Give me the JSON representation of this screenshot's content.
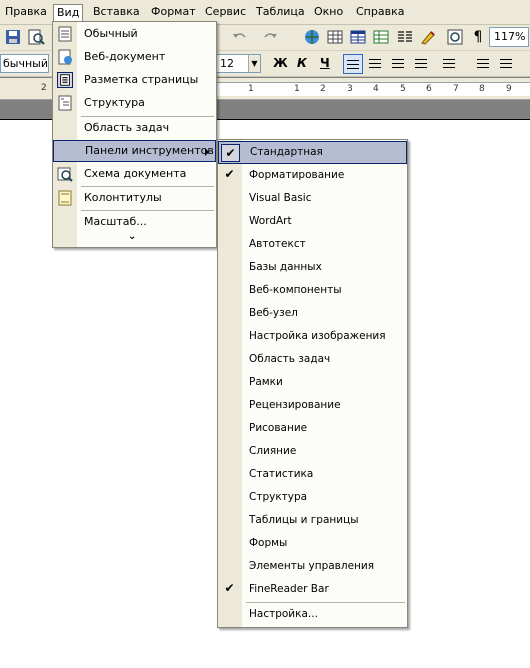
{
  "menubar": {
    "items": [
      {
        "label": "Правка"
      },
      {
        "label": "Вид"
      },
      {
        "label": "Вставка"
      },
      {
        "label": "Формат"
      },
      {
        "label": "Сервис"
      },
      {
        "label": "Таблица"
      },
      {
        "label": "Окно"
      },
      {
        "label": "Справка"
      }
    ],
    "active": "Вид"
  },
  "toolbar": {
    "zoom": "117%",
    "style": "бычный",
    "font_size": "12",
    "bold": "Ж",
    "italic": "К",
    "underline": "Ч"
  },
  "ruler": {
    "marks": [
      "2",
      "1",
      "1",
      "2",
      "3",
      "4",
      "5",
      "6",
      "7",
      "8",
      "9"
    ]
  },
  "view_menu": {
    "items": [
      {
        "label": "Обычный",
        "icon": "normal-view-icon"
      },
      {
        "label": "Веб-документ",
        "icon": "web-layout-icon"
      },
      {
        "label": "Разметка страницы",
        "icon": "print-layout-icon",
        "checked": true
      },
      {
        "label": "Структура",
        "icon": "outline-view-icon"
      },
      {
        "label": "Область задач"
      },
      {
        "label": "Панели инструментов",
        "submenu": true,
        "highlighted": true
      },
      {
        "label": "Схема документа",
        "icon": "document-map-icon"
      },
      {
        "label": "Колонтитулы",
        "icon": "header-footer-icon"
      },
      {
        "label": "Масштаб..."
      }
    ],
    "expand_glyph": "⌄"
  },
  "toolbars_submenu": {
    "items": [
      {
        "label": "Стандартная",
        "checked": true,
        "highlighted": true
      },
      {
        "label": "Форматирование",
        "checked": true
      },
      {
        "label": "Visual Basic"
      },
      {
        "label": "WordArt"
      },
      {
        "label": "Автотекст"
      },
      {
        "label": "Базы данных"
      },
      {
        "label": "Веб-компоненты"
      },
      {
        "label": "Веб-узел"
      },
      {
        "label": "Настройка изображения"
      },
      {
        "label": "Область задач"
      },
      {
        "label": "Рамки"
      },
      {
        "label": "Рецензирование"
      },
      {
        "label": "Рисование"
      },
      {
        "label": "Слияние"
      },
      {
        "label": "Статистика"
      },
      {
        "label": "Структура"
      },
      {
        "label": "Таблицы и границы"
      },
      {
        "label": "Формы"
      },
      {
        "label": "Элементы управления"
      },
      {
        "label": "FineReader Bar",
        "checked": true
      },
      {
        "label": "Настройка..."
      }
    ],
    "check_glyph": "✔"
  }
}
